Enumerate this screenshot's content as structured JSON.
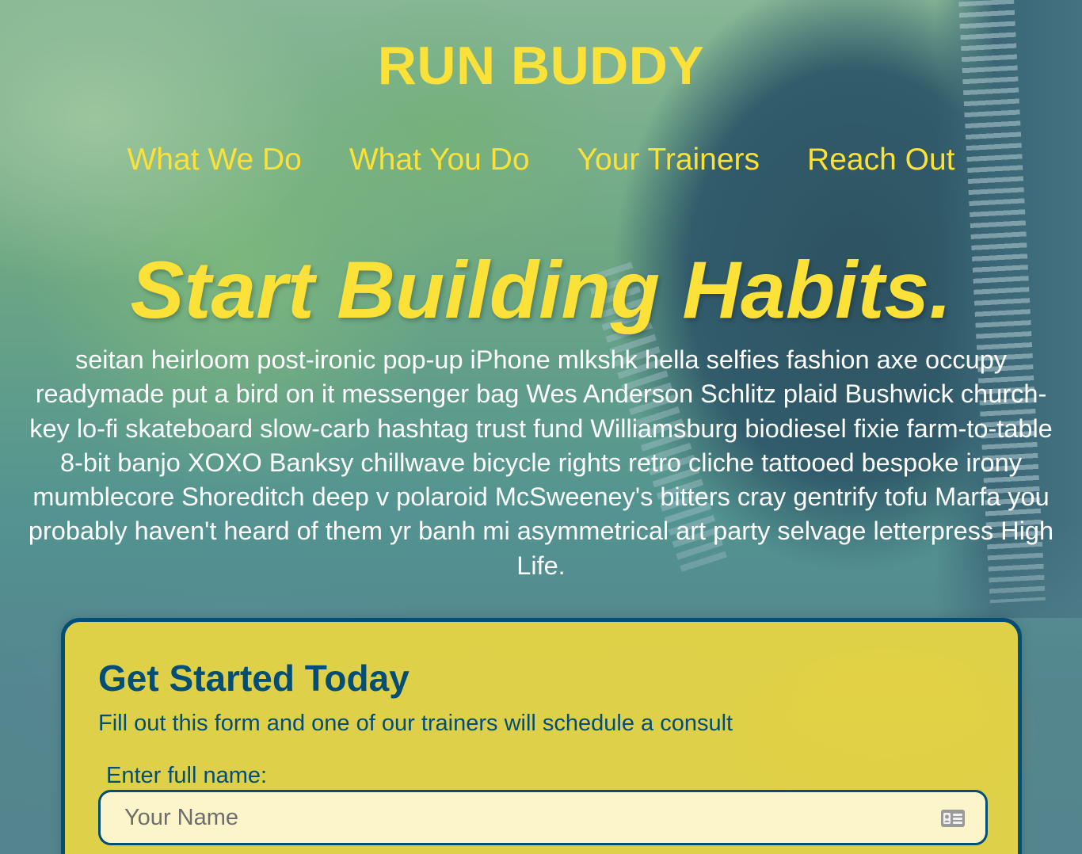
{
  "header": {
    "site_title": "RUN BUDDY",
    "nav": [
      {
        "label": "What We Do"
      },
      {
        "label": "What You Do"
      },
      {
        "label": "Your Trainers"
      },
      {
        "label": "Reach Out"
      }
    ]
  },
  "hero": {
    "title": "Start Building Habits.",
    "text": "seitan heirloom post-ironic pop-up iPhone mlkshk hella selfies fashion axe occupy readymade put a bird on it messenger bag Wes Anderson Schlitz plaid Bushwick church-key lo-fi skateboard slow-carb hashtag trust fund Williamsburg biodiesel fixie farm-to-table 8-bit banjo XOXO Banksy chillwave bicycle rights retro cliche tattooed bespoke irony mumblecore Shoreditch deep v polaroid McSweeney's bitters cray gentrify tofu Marfa you probably haven't heard of them yr banh mi asymmetrical art party selvage letterpress High Life."
  },
  "signup_form": {
    "title": "Get Started Today",
    "subtitle": "Fill out this form and one of our trainers will schedule a consult",
    "name_label": "Enter full name:",
    "name_value": "",
    "name_placeholder": "Your Name",
    "name_icon": "contact-card-icon"
  },
  "colors": {
    "accent_yellow": "#fce138",
    "brand_blue": "#024e76",
    "hero_text": "#ffffff"
  }
}
